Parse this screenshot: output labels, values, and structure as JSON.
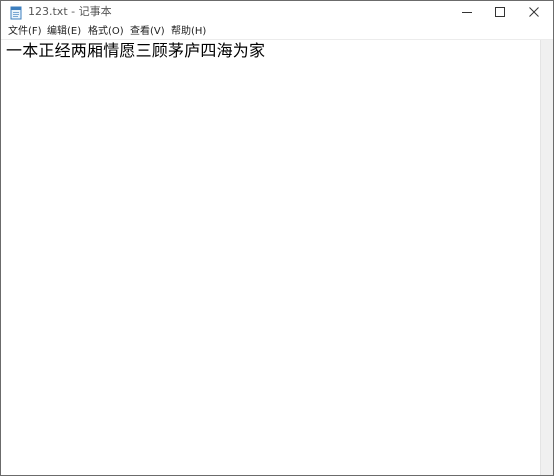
{
  "window": {
    "title": "123.txt - 记事本"
  },
  "titlebar_icons": {
    "app": "notepad-icon",
    "minimize": "minimize-icon",
    "maximize": "maximize-icon",
    "close": "close-icon"
  },
  "menu": {
    "items": [
      {
        "label": "文件(F)"
      },
      {
        "label": "编辑(E)"
      },
      {
        "label": "格式(O)"
      },
      {
        "label": "查看(V)"
      },
      {
        "label": "帮助(H)"
      }
    ]
  },
  "editor": {
    "content": "一本正经两厢情愿三顾茅庐四海为家"
  },
  "colors": {
    "border": "#6b6b6b",
    "text": "#000000",
    "menu_text": "#222222",
    "title_text": "#555555",
    "scrollbar": "#f0f0f0"
  }
}
